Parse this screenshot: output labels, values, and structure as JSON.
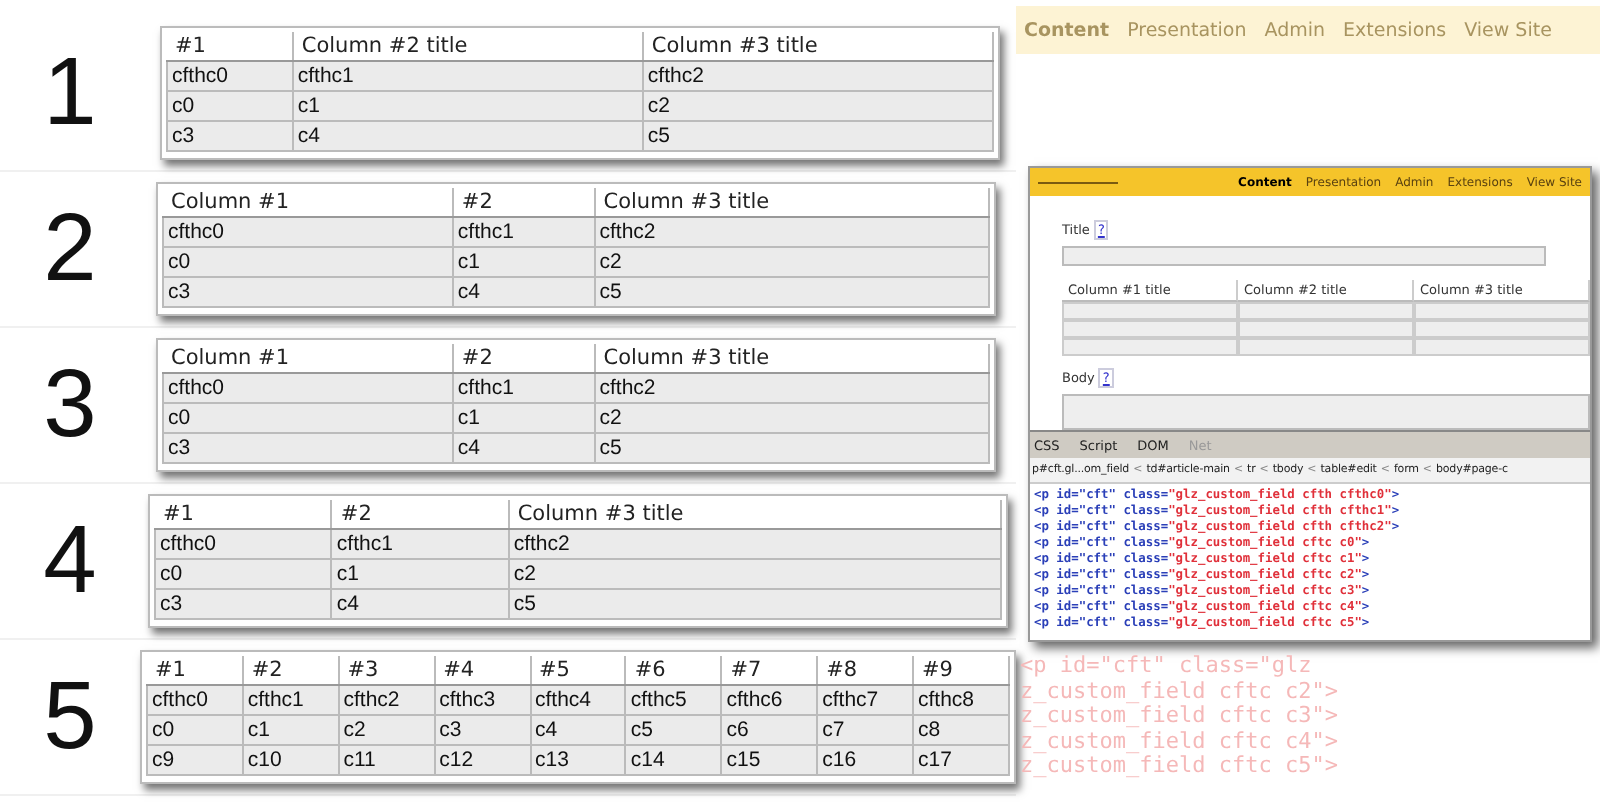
{
  "examples": [
    {
      "number": "1",
      "columns": [
        "#1",
        "Column #2 title",
        "Column #3 title"
      ],
      "rows": [
        [
          "cfthc0",
          "cfthc1",
          "cfthc2"
        ],
        [
          "c0",
          "c1",
          "c2"
        ],
        [
          "c3",
          "c4",
          "c5"
        ]
      ]
    },
    {
      "number": "2",
      "columns": [
        "Column #1",
        "#2",
        "Column #3 title"
      ],
      "rows": [
        [
          "cfthc0",
          "cfthc1",
          "cfthc2"
        ],
        [
          "c0",
          "c1",
          "c2"
        ],
        [
          "c3",
          "c4",
          "c5"
        ]
      ]
    },
    {
      "number": "3",
      "columns": [
        "Column #1",
        "#2",
        "Column #3 title"
      ],
      "rows": [
        [
          "cfthc0",
          "cfthc1",
          "cfthc2"
        ],
        [
          "c0",
          "c1",
          "c2"
        ],
        [
          "c3",
          "c4",
          "c5"
        ]
      ]
    },
    {
      "number": "4",
      "columns": [
        "#1",
        "#2",
        "Column #3 title"
      ],
      "rows": [
        [
          "cfthc0",
          "cfthc1",
          "cfthc2"
        ],
        [
          "c0",
          "c1",
          "c2"
        ],
        [
          "c3",
          "c4",
          "c5"
        ]
      ]
    },
    {
      "number": "5",
      "columns": [
        "#1",
        "#2",
        "#3",
        "#4",
        "#5",
        "#6",
        "#7",
        "#8",
        "#9"
      ],
      "rows": [
        [
          "cfthc0",
          "cfthc1",
          "cfthc2",
          "cfthc3",
          "cfthc4",
          "cfthc5",
          "cfthc6",
          "cfthc7",
          "cfthc8"
        ],
        [
          "c0",
          "c1",
          "c2",
          "c3",
          "c4",
          "c5",
          "c6",
          "c7",
          "c8"
        ],
        [
          "c9",
          "c10",
          "c11",
          "c12",
          "c13",
          "c14",
          "c15",
          "c16",
          "c17"
        ]
      ]
    }
  ],
  "background_page": {
    "nav": [
      "Content",
      "Presentation",
      "Admin",
      "Extensions",
      "View Site"
    ],
    "code_lines": [
      "<p id=\"cft\" class=\"glz",
      "z_custom_field cftc c2\">",
      "z_custom_field cftc c3\">",
      "z_custom_field cftc c4\">",
      "z_custom_field cftc c5\">"
    ]
  },
  "editor_window": {
    "nav": [
      {
        "label": "Content",
        "selected": true
      },
      {
        "label": "Presentation",
        "selected": false
      },
      {
        "label": "Admin",
        "selected": false
      },
      {
        "label": "Extensions",
        "selected": false
      },
      {
        "label": "View Site",
        "selected": false
      }
    ],
    "title_label": "Title",
    "title_help": "?",
    "table_columns": [
      "Column #1 title",
      "Column #2 title",
      "Column #3 title"
    ],
    "body_label": "Body",
    "body_help": "?"
  },
  "devtools": {
    "tabs": [
      {
        "label": "CSS",
        "disabled": false
      },
      {
        "label": "Script",
        "disabled": false
      },
      {
        "label": "DOM",
        "disabled": false
      },
      {
        "label": "Net",
        "disabled": true
      }
    ],
    "breadcrumb": [
      "p#cft.gl...om_field",
      "td#article-main",
      "tr",
      "tbody",
      "table#edit",
      "form",
      "body#page-c"
    ],
    "separator": "<",
    "lines": [
      {
        "tag": "<p id=\"cft\" class=",
        "value": "\"glz_custom_field cfth cfthc0\"",
        "end": ">"
      },
      {
        "tag": "<p id=\"cft\" class=",
        "value": "\"glz_custom_field cfth cfthc1\"",
        "end": ">"
      },
      {
        "tag": "<p id=\"cft\" class=",
        "value": "\"glz_custom_field cfth cfthc2\"",
        "end": ">"
      },
      {
        "tag": "<p id=\"cft\" class=",
        "value": "\"glz_custom_field cftc c0\"",
        "end": ">"
      },
      {
        "tag": "<p id=\"cft\" class=",
        "value": "\"glz_custom_field cftc c1\"",
        "end": ">"
      },
      {
        "tag": "<p id=\"cft\" class=",
        "value": "\"glz_custom_field cftc c2\"",
        "end": ">"
      },
      {
        "tag": "<p id=\"cft\" class=",
        "value": "\"glz_custom_field cftc c3\"",
        "end": ">"
      },
      {
        "tag": "<p id=\"cft\" class=",
        "value": "\"glz_custom_field cftc c4\"",
        "end": ">"
      },
      {
        "tag": "<p id=\"cft\" class=",
        "value": "\"glz_custom_field cftc c5\"",
        "end": ">"
      }
    ]
  }
}
